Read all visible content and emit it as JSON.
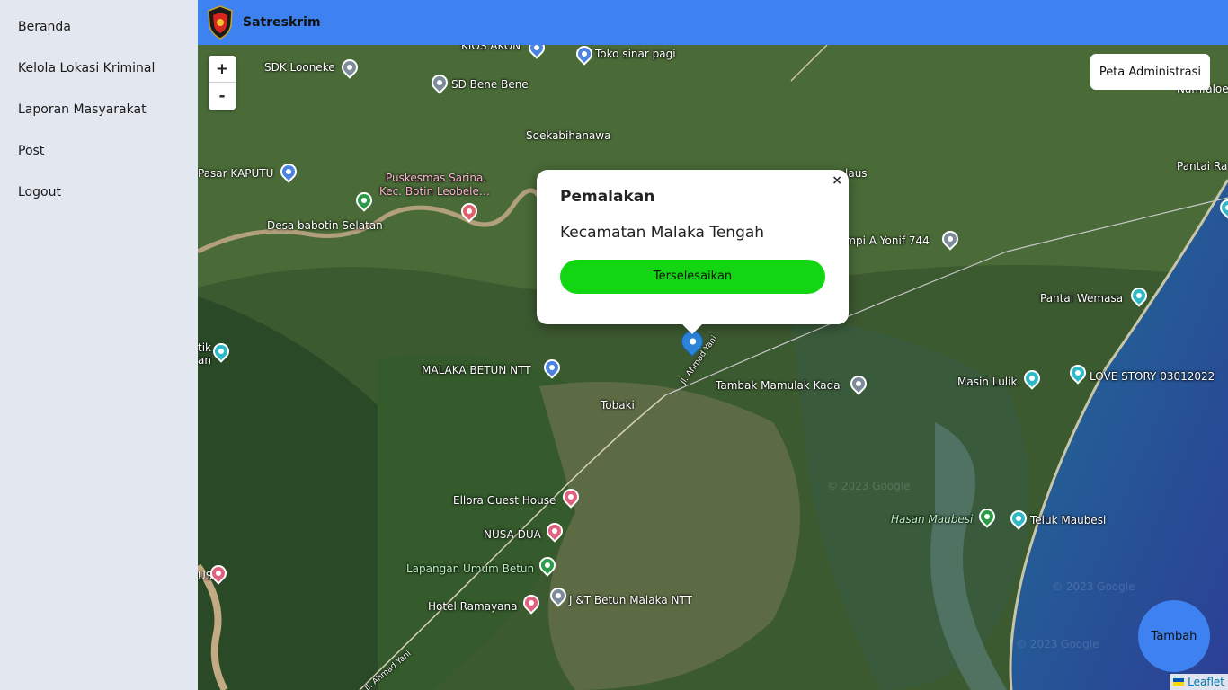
{
  "sidebar": {
    "items": [
      {
        "label": "Beranda"
      },
      {
        "label": "Kelola Lokasi Kriminal"
      },
      {
        "label": "Laporan Masyarakat"
      },
      {
        "label": "Post"
      },
      {
        "label": "Logout"
      }
    ]
  },
  "header": {
    "title": "Satreskrim"
  },
  "map": {
    "zoom_in_label": "+",
    "zoom_out_label": "-",
    "layer_button_label": "Peta Administrasi",
    "fab_label": "Tambah",
    "attribution": "Leaflet",
    "watermark": "© 2023 Google",
    "places": [
      "KIOS AKON",
      "Toko sinar pagi",
      "SDK Looneke",
      "SD Bene Bene",
      "Soekabihanawa",
      "Pasar KAPUTU",
      "Puskesmas Sarina,",
      "Kec. Botin Leobele…",
      "Desa babotin Selatan",
      "laus",
      "ompi A Yonif 744",
      "Pantai Ra",
      "Namfaloes",
      "Pantai Wemasa",
      "tik",
      "an",
      "MALAKA BETUN NTT",
      "Tobaki",
      "Tambak Mamulak Kada",
      "Masin Lulik",
      "LOVE STORY 03012022",
      "Ellora Guest House",
      "NUSA DUA",
      "Lapangan Umum Betun",
      "Hotel Ramayana",
      "J &T Betun Malaka NTT",
      "Hasan Maubesi",
      "Teluk Maubesi",
      "US",
      "Jl. Ahmad Yani",
      "Jl. Ahmad Yani"
    ]
  },
  "popup": {
    "close_label": "×",
    "title": "Pemalakan",
    "subtitle": "Kecamatan Malaka Tengah",
    "status": "Terselesaikan",
    "status_color": "#11d611"
  },
  "colors": {
    "header": "#3d82f0",
    "sidebar": "#e3e8f0",
    "marker": "#2c83d8"
  }
}
